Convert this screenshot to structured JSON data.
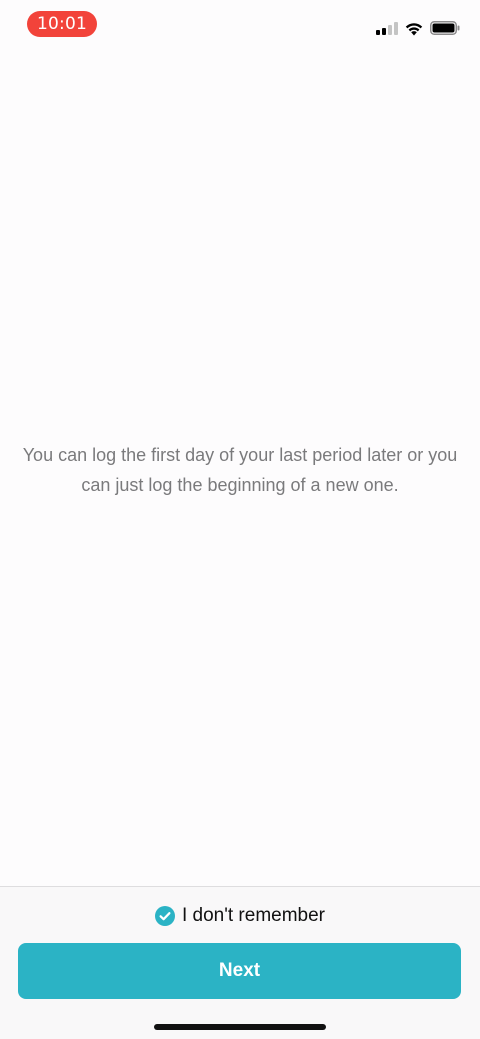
{
  "status_bar": {
    "time": "10:01",
    "time_pill_color": "#f2433a",
    "signal_icon": "cellular-signal-icon",
    "wifi_icon": "wifi-icon",
    "battery_icon": "battery-icon"
  },
  "main": {
    "message": "You can log the first day of your last period later or you can just log the beginning of a new one."
  },
  "footer": {
    "remember_label": "I don't remember",
    "remember_checked": true,
    "check_icon": "checkmark-circle-icon",
    "next_label": "Next",
    "accent_color": "#2bb3c5"
  }
}
